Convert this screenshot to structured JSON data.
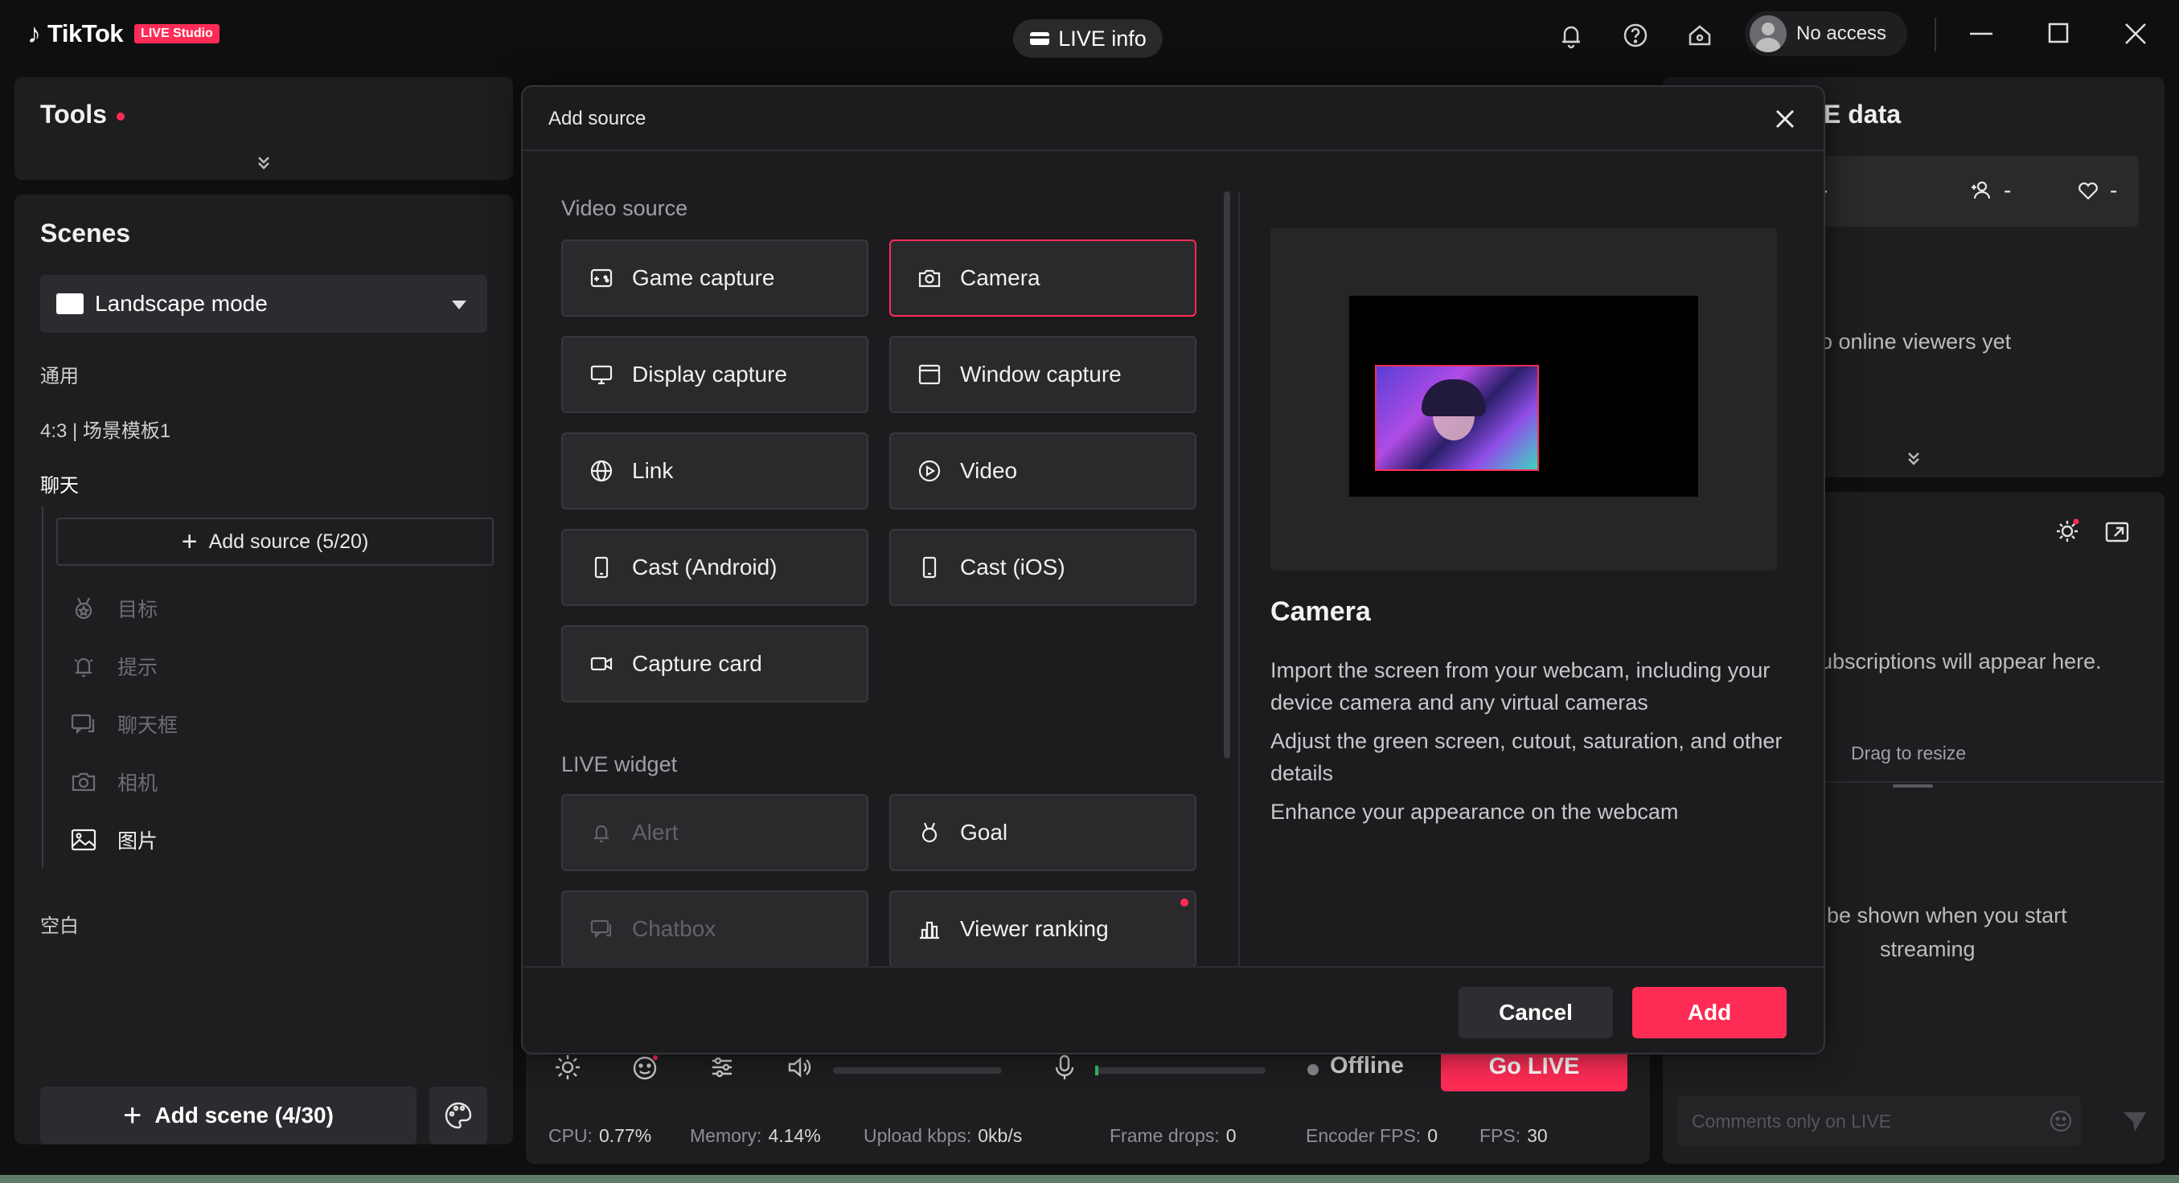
{
  "titlebar": {
    "logo_text": "TikTok",
    "logo_badge": "LIVE Studio",
    "live_info": "LIVE info",
    "account": "No access"
  },
  "tools": {
    "title": "Tools"
  },
  "scenes": {
    "title": "Scenes",
    "mode": "Landscape mode",
    "labels": [
      "通用",
      "4:3 | 场景模板1",
      "聊天",
      "空白"
    ],
    "add_source": "Add source (5/20)",
    "sources": [
      {
        "label": "目标",
        "icon": "medal-icon",
        "enabled": false
      },
      {
        "label": "提示",
        "icon": "alert-bell-icon",
        "enabled": false
      },
      {
        "label": "聊天框",
        "icon": "chatbox-icon",
        "enabled": false
      },
      {
        "label": "相机",
        "icon": "camera-icon",
        "enabled": false
      },
      {
        "label": "图片",
        "icon": "image-icon",
        "enabled": true
      }
    ],
    "add_scene": "Add scene (4/30)"
  },
  "center": {
    "status": "Offline",
    "go_live": "Go LIVE",
    "stats": [
      {
        "label": "CPU:",
        "value": "0.77%"
      },
      {
        "label": "Memory:",
        "value": "4.14%"
      },
      {
        "label": "Upload kbps:",
        "value": "0kb/s"
      },
      {
        "label": "Frame drops:",
        "value": "0"
      },
      {
        "label": "Encoder FPS:",
        "value": "0"
      },
      {
        "label": "FPS:",
        "value": "30"
      }
    ]
  },
  "right": {
    "title_partial": "E data",
    "stat_values": [
      "-",
      "-",
      "-"
    ],
    "no_viewers": "o online viewers yet",
    "subscriptions": "ubscriptions will appear here.",
    "drag_resize": "Drag to resize",
    "shown_when_line1": "be shown when you start",
    "shown_when_line2": "streaming",
    "comment_placeholder": "Comments only on LIVE"
  },
  "modal": {
    "title": "Add source",
    "video_section": "Video source",
    "widget_section": "LIVE widget",
    "video_sources": [
      {
        "label": "Game capture",
        "icon": "gamepad-icon",
        "selected": false
      },
      {
        "label": "Camera",
        "icon": "camera-icon",
        "selected": true
      },
      {
        "label": "Display capture",
        "icon": "monitor-icon",
        "selected": false
      },
      {
        "label": "Window capture",
        "icon": "window-icon",
        "selected": false
      },
      {
        "label": "Link",
        "icon": "globe-icon",
        "selected": false
      },
      {
        "label": "Video",
        "icon": "play-icon",
        "selected": false
      },
      {
        "label": "Cast (Android)",
        "icon": "phone-icon",
        "selected": false
      },
      {
        "label": "Cast (iOS)",
        "icon": "phone-icon",
        "selected": false
      },
      {
        "label": "Capture card",
        "icon": "video-camera-icon",
        "selected": false
      }
    ],
    "widgets": [
      {
        "label": "Alert",
        "icon": "alert-bell-icon",
        "disabled": true
      },
      {
        "label": "Goal",
        "icon": "medal-icon",
        "disabled": false
      },
      {
        "label": "Chatbox",
        "icon": "chatbox-icon",
        "disabled": true
      },
      {
        "label": "Viewer ranking",
        "icon": "ranking-icon",
        "disabled": false,
        "new": true
      }
    ],
    "preview_title": "Camera",
    "description": [
      "Import the screen from your webcam, including your device camera and any virtual cameras",
      "Adjust the green screen, cutout, saturation, and other details",
      "Enhance your appearance on the webcam"
    ],
    "cancel": "Cancel",
    "add": "Add"
  },
  "colors": {
    "accent": "#fe2c55",
    "panel": "#1e1e21",
    "background": "#0f0f11"
  }
}
